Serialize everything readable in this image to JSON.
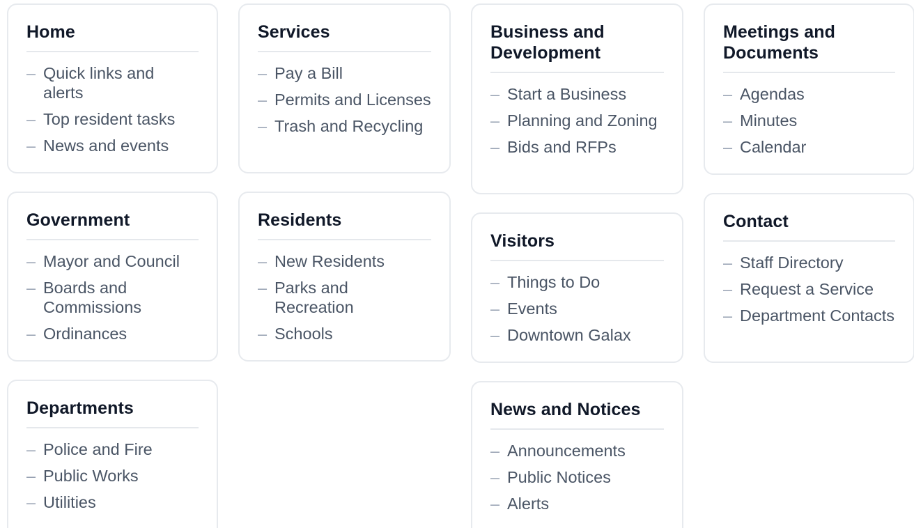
{
  "sections": {
    "home": {
      "title": "Home",
      "items": [
        "Quick links and alerts",
        "Top resident tasks",
        "News and events"
      ]
    },
    "services": {
      "title": "Services",
      "items": [
        "Pay a Bill",
        "Permits and Licenses",
        "Trash and Recycling"
      ]
    },
    "business": {
      "title": "Business and Development",
      "items": [
        "Start a Business",
        "Planning and Zoning",
        "Bids and RFPs"
      ]
    },
    "meetings": {
      "title": "Meetings and Documents",
      "items": [
        "Agendas",
        "Minutes",
        "Calendar"
      ]
    },
    "government": {
      "title": "Government",
      "items": [
        "Mayor and Council",
        "Boards and Commissions",
        "Ordinances"
      ]
    },
    "residents": {
      "title": "Residents",
      "items": [
        "New Residents",
        "Parks and Recreation",
        "Schools"
      ]
    },
    "visitors": {
      "title": "Visitors",
      "items": [
        "Things to Do",
        "Events",
        "Downtown Galax"
      ]
    },
    "contact": {
      "title": "Contact",
      "items": [
        "Staff Directory",
        "Request a Service",
        "Department Contacts"
      ]
    },
    "departments": {
      "title": "Departments",
      "items": [
        "Police and Fire",
        "Public Works",
        "Utilities"
      ]
    },
    "news": {
      "title": "News and Notices",
      "items": [
        "Announcements",
        "Public Notices",
        "Alerts"
      ]
    }
  },
  "bullet_glyph": "–"
}
